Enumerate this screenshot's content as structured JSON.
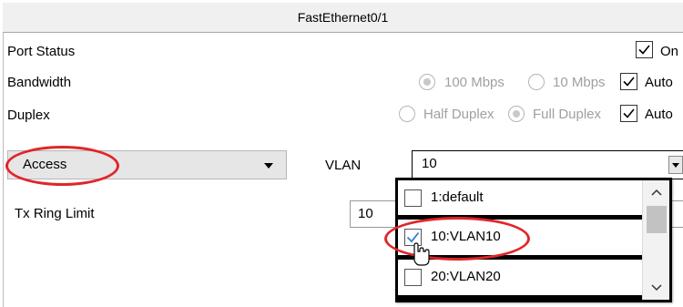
{
  "panel": {
    "title": "FastEthernet0/1"
  },
  "port_status": {
    "label": "Port Status",
    "on_label": "On",
    "on_checked": true
  },
  "bandwidth": {
    "label": "Bandwidth",
    "option_100": "100 Mbps",
    "option_10": "10 Mbps",
    "auto_label": "Auto",
    "auto_checked": true
  },
  "duplex": {
    "label": "Duplex",
    "option_half": "Half Duplex",
    "option_full": "Full Duplex",
    "auto_label": "Auto",
    "auto_checked": true
  },
  "mode": {
    "selected": "Access"
  },
  "vlan": {
    "label": "VLAN",
    "value": "10",
    "options": [
      {
        "label": "1:default",
        "checked": false
      },
      {
        "label": "10:VLAN10",
        "checked": true
      },
      {
        "label": "20:VLAN20",
        "checked": false
      }
    ]
  },
  "tx_ring": {
    "label": "Tx Ring Limit",
    "value": "10"
  },
  "colors": {
    "annotation": "#e0262a",
    "check": "#2d7fd3",
    "disabled_text": "#a0a0a0"
  }
}
